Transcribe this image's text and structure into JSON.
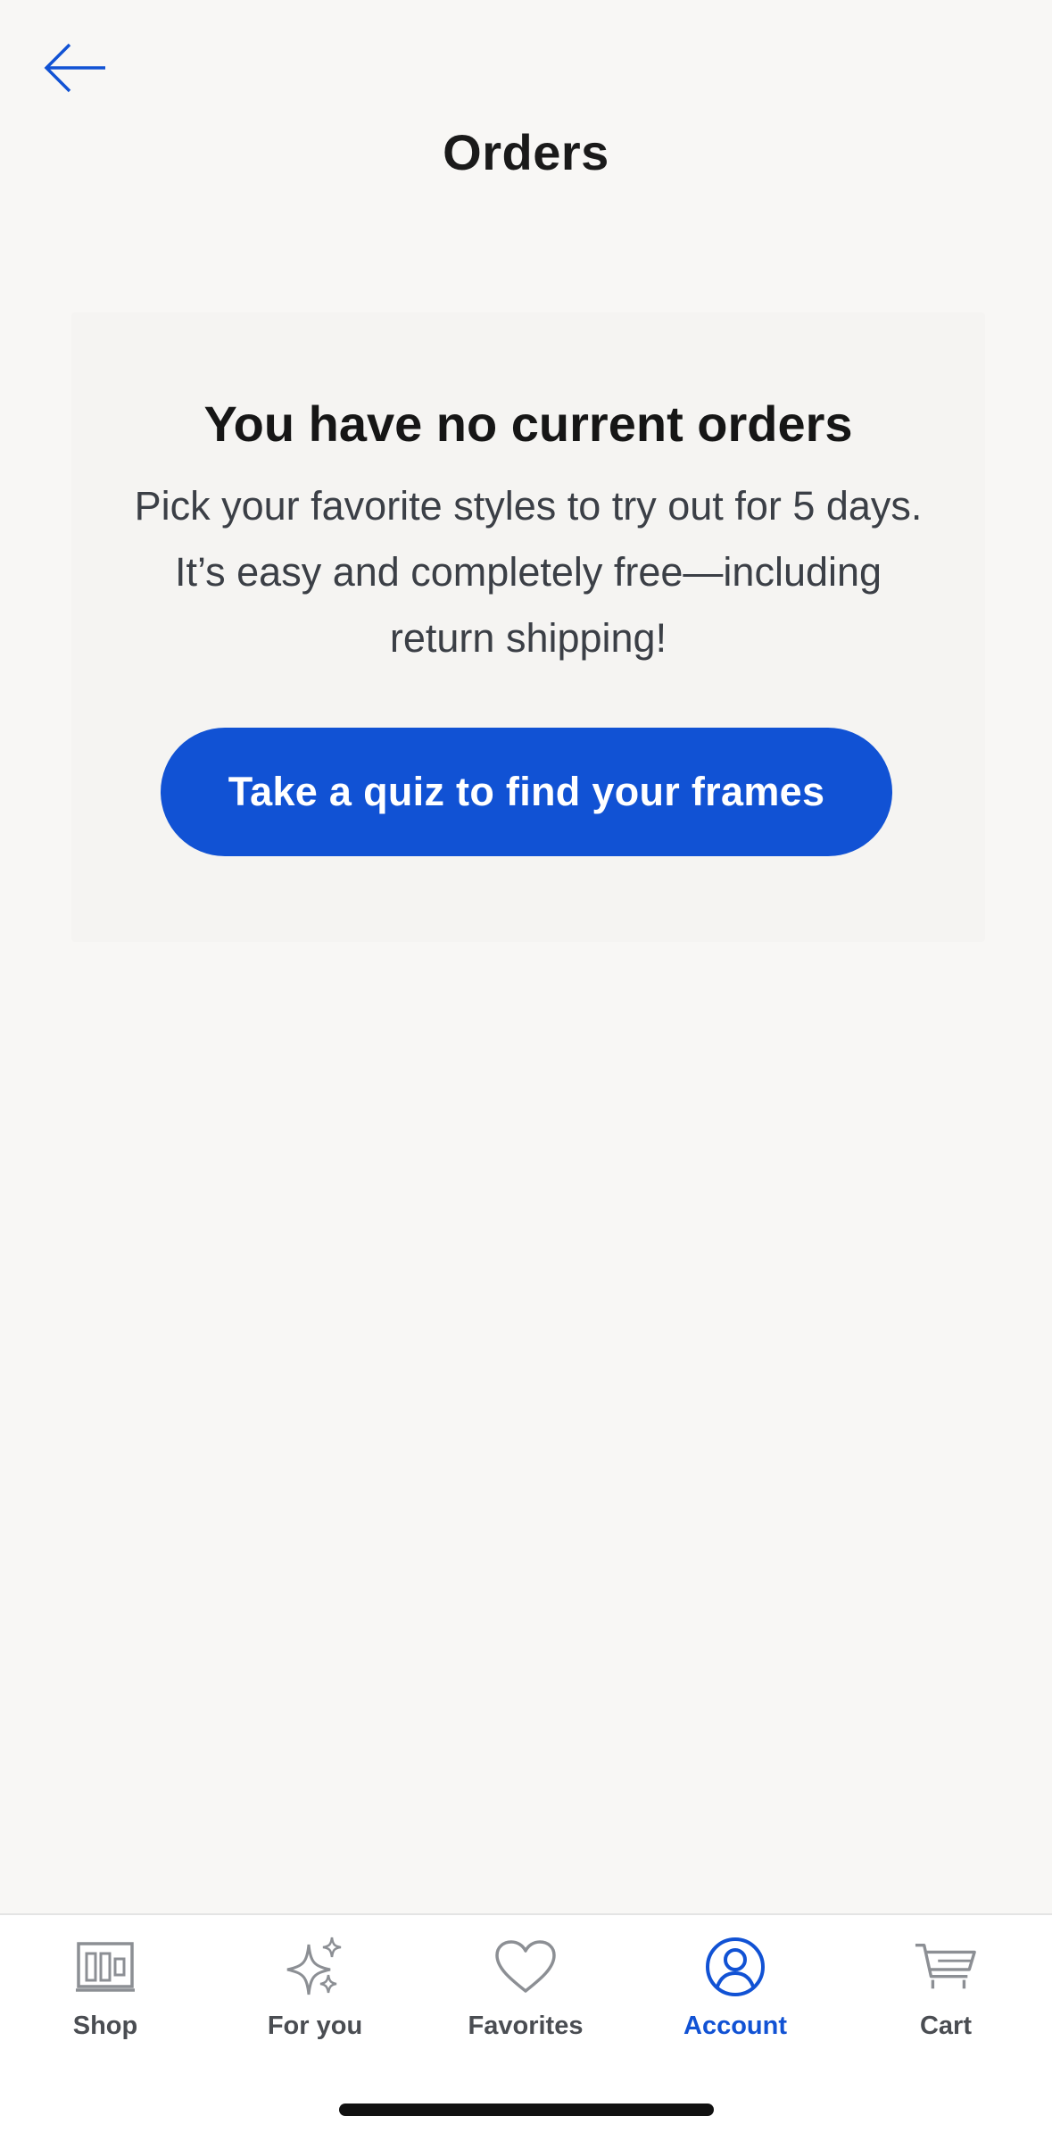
{
  "header": {
    "title": "Orders"
  },
  "empty_state": {
    "heading": "You have no current orders",
    "body": "Pick your favorite styles to try out for 5 days. It’s easy and completely free—including return shipping!",
    "cta_label": "Take a quiz to find your frames"
  },
  "tabbar": {
    "tabs": [
      {
        "label": "Shop",
        "icon": "shop-icon"
      },
      {
        "label": "For you",
        "icon": "sparkle-icon"
      },
      {
        "label": "Favorites",
        "icon": "heart-icon"
      },
      {
        "label": "Account",
        "icon": "account-icon",
        "active": true
      },
      {
        "label": "Cart",
        "icon": "cart-icon"
      }
    ]
  },
  "colors": {
    "accent": "#1152d4",
    "background": "#f8f7f5",
    "inactive_tab": "#4a4d52"
  }
}
